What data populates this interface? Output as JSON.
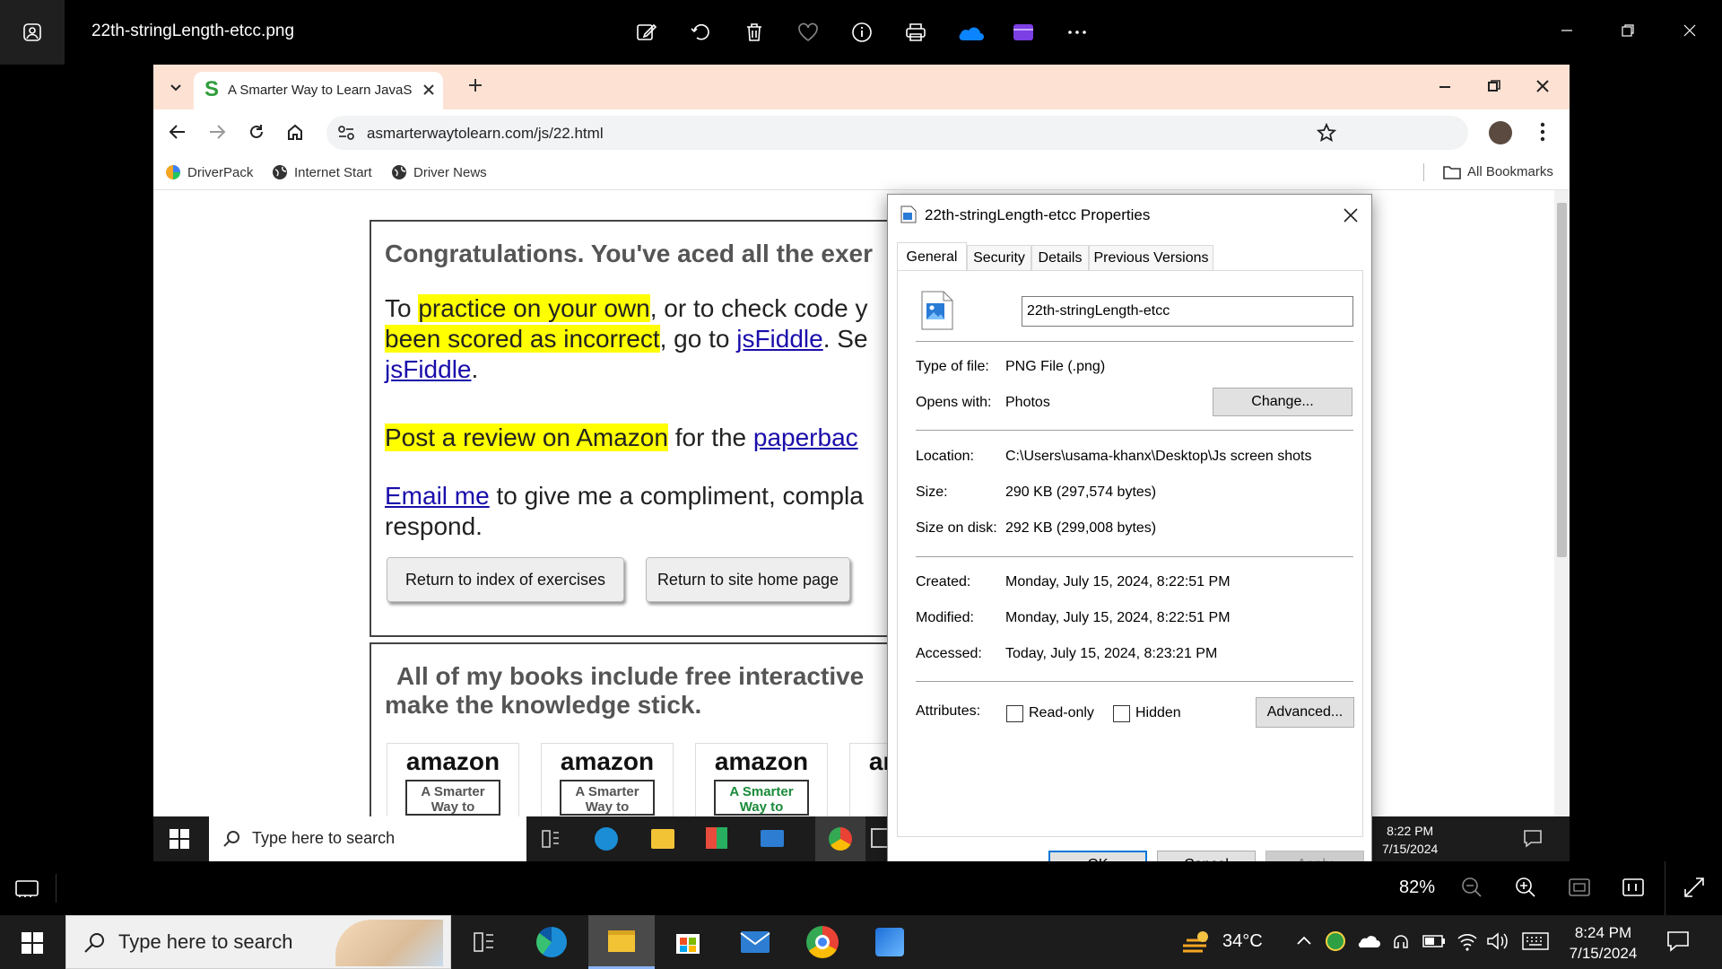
{
  "viewer": {
    "title": "22th-stringLength-etcc.png",
    "zoom_level": "82%",
    "icons": [
      "edit-icon",
      "rotate-icon",
      "delete-icon",
      "favorite-icon",
      "info-icon",
      "print-icon",
      "onedrive-icon",
      "clipchamp-icon",
      "more-icon"
    ]
  },
  "browser": {
    "tab_title": "A Smarter Way to Learn JavaScript",
    "url": "asmarterwaytolearn.com/js/22.html",
    "bookmarks": [
      "DriverPack",
      "Internet Start",
      "Driver News"
    ],
    "all_bookmarks": "All Bookmarks"
  },
  "webpage": {
    "heading": "Congratulations. You've aced all the exer",
    "p1_a": "To ",
    "p1_hl1": "practice on your own",
    "p1_b": ", or to check code y",
    "p1_hl2": "been scored as incorrect",
    "p1_c": ", go to ",
    "p1_link1": "jsFiddle",
    "p1_d": ". Se",
    "p1_link2": "jsFiddle",
    "p1_e": ".",
    "p2_hl": "Post a review on Amazon",
    "p2_a": " for the ",
    "p2_link": "paperbac",
    "p3_link": "Email me",
    "p3_a": " to give me a compliment, compla",
    "p3_b": "respond.",
    "btn_index": "Return to index of exercises",
    "btn_home": "Return to site home page",
    "books_heading_1": "All of my books include free interactive",
    "books_heading_2": "make the knowledge stick.",
    "amazon_label": "amazon",
    "book_label_1": "A Smarter Way to",
    "book_label_2": "A Smarter Way to",
    "book_label_3": "A Smarter Way to"
  },
  "inner_taskbar": {
    "search_placeholder": "Type here to search",
    "time": "8:22 PM",
    "date": "7/15/2024"
  },
  "dialog": {
    "title": "22th-stringLength-etcc Properties",
    "tabs": [
      "General",
      "Security",
      "Details",
      "Previous Versions"
    ],
    "file_name": "22th-stringLength-etcc",
    "type_label": "Type of file:",
    "type_value": "PNG File (.png)",
    "opens_label": "Opens with:",
    "opens_value": "Photos",
    "change_button": "Change...",
    "location_label": "Location:",
    "location_value": "C:\\Users\\usama-khanx\\Desktop\\Js screen shots",
    "size_label": "Size:",
    "size_value": "290 KB (297,574 bytes)",
    "size_disk_label": "Size on disk:",
    "size_disk_value": "292 KB (299,008 bytes)",
    "created_label": "Created:",
    "created_value": "Monday, July 15, 2024, 8:22:51 PM",
    "modified_label": "Modified:",
    "modified_value": "Monday, July 15, 2024, 8:22:51 PM",
    "accessed_label": "Accessed:",
    "accessed_value": "Today, July 15, 2024, 8:23:21 PM",
    "attributes_label": "Attributes:",
    "readonly_label": "Read-only",
    "hidden_label": "Hidden",
    "advanced_button": "Advanced...",
    "ok_button": "OK",
    "cancel_button": "Cancel",
    "apply_button": "Apply"
  },
  "taskbar": {
    "search_placeholder": "Type here to search",
    "temperature": "34°C",
    "time": "8:24 PM",
    "date": "7/15/2024"
  },
  "colors": {
    "tab_strip": "#fde2d4",
    "highlight": "#ffff00",
    "link": "#1a0dab",
    "taskbar": "#1c1c1c"
  }
}
